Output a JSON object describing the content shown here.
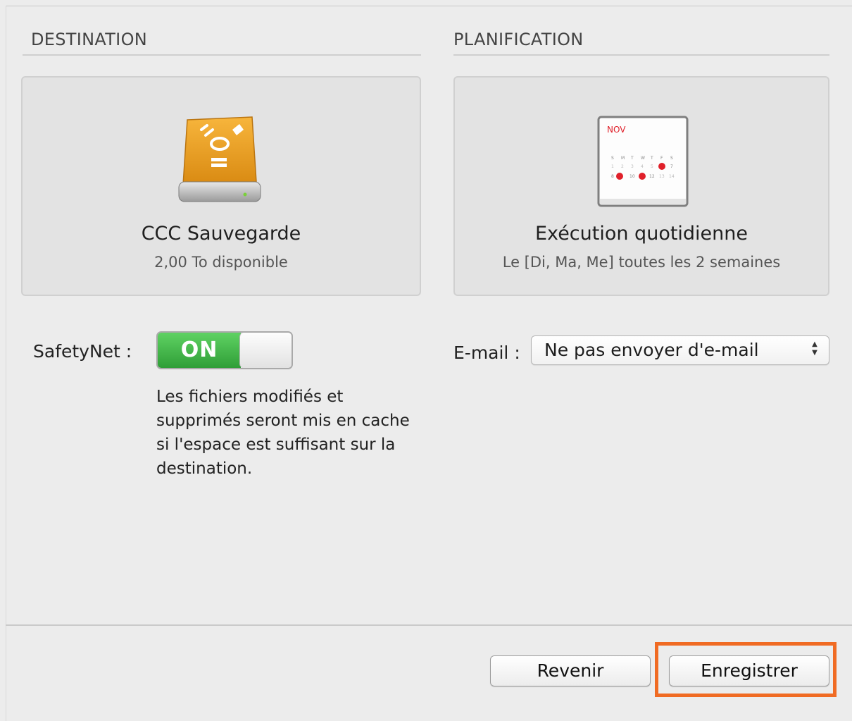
{
  "destination": {
    "section_title": "DESTINATION",
    "name": "CCC Sauvegarde",
    "available": "2,00 To disponible",
    "icon": "firewire-drive-icon"
  },
  "schedule": {
    "section_title": "PLANIFICATION",
    "calendar_month": "NOV",
    "calendar_days": [
      "S",
      "M",
      "T",
      "W",
      "T",
      "F",
      "S"
    ],
    "name": "Exécution quotidienne",
    "detail": "Le [Di, Ma, Me] toutes les 2 semaines",
    "icon": "calendar-icon"
  },
  "safetynet": {
    "label": "SafetyNet :",
    "toggle_state": "ON",
    "description": "Les fichiers modifiés et supprimés seront mis en cache si l'espace est suffisant sur la destination."
  },
  "email": {
    "label": "E-mail :",
    "selected": "Ne pas envoyer d'e-mail"
  },
  "footer": {
    "revert_label": "Revenir",
    "save_label": "Enregistrer"
  },
  "colors": {
    "toggle_on": "#3fb447",
    "highlight": "#f06b23",
    "drive": "#f0a030",
    "calendar_mark": "#e0202a"
  }
}
